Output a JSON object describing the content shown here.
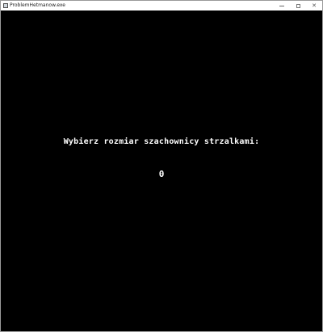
{
  "window": {
    "title": "ProblemHetmanow.exe",
    "controls": {
      "minimize_icon": "minimize-icon",
      "maximize_icon": "maximize-icon",
      "close_label": "✕"
    }
  },
  "game": {
    "prompt": "Wybierz rozmiar szachownicy strzalkami:",
    "board_size_value": "0",
    "background_color": "#000000",
    "text_color": "#ffffff"
  }
}
